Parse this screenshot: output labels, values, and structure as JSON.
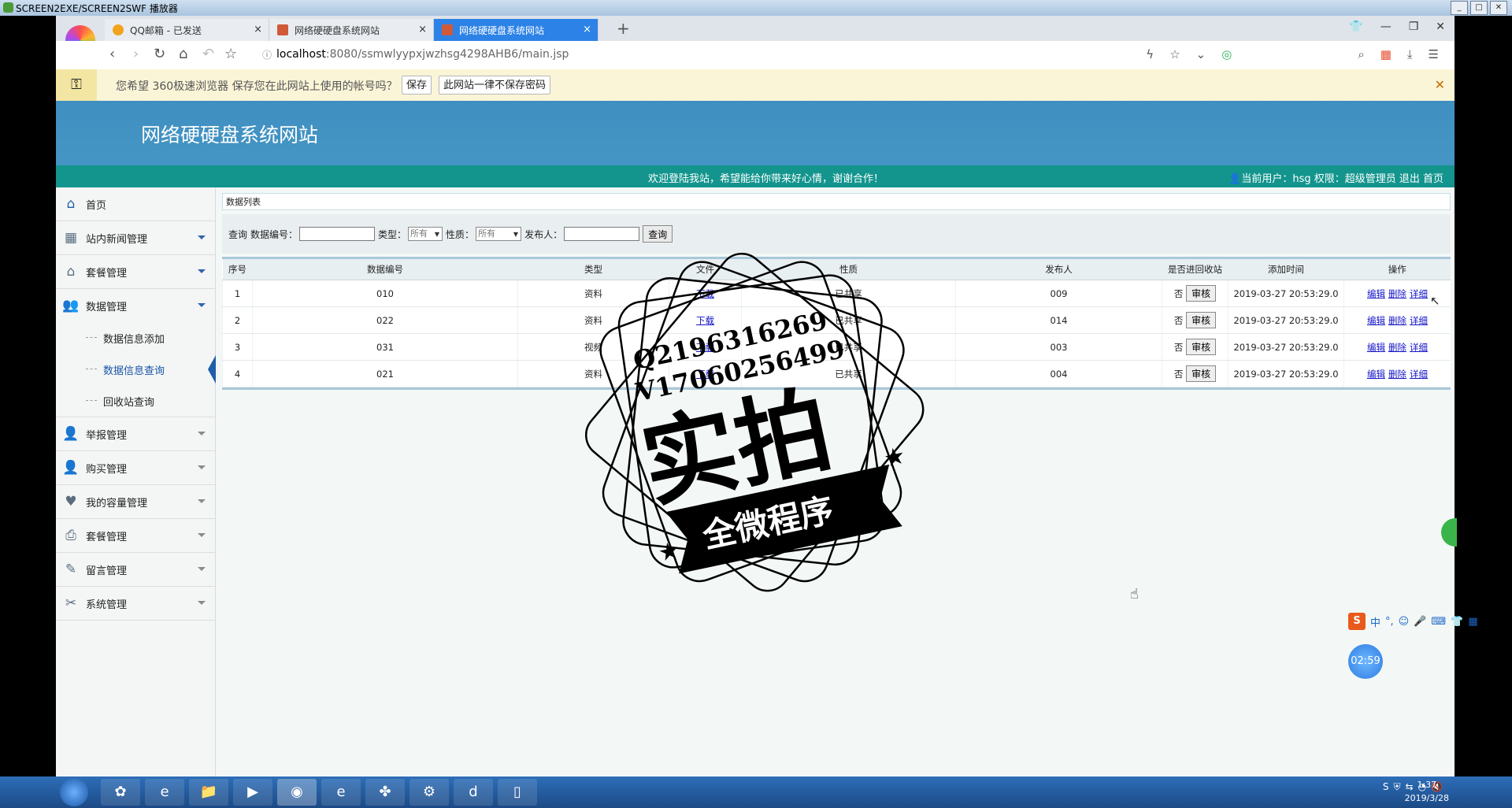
{
  "player": {
    "title": "SCREEN2EXE/SCREEN2SWF 播放器"
  },
  "browser": {
    "tabs": [
      {
        "title": "QQ邮箱 - 已发送",
        "active": false
      },
      {
        "title": "网络硬硬盘系统网站",
        "active": false
      },
      {
        "title": "网络硬硬盘系统网站",
        "active": true
      }
    ],
    "url": {
      "host": "localhost",
      "path": ":8080/ssmwlyypxjwzhsg4298AHB6/main.jsp"
    },
    "password_bar": {
      "message": "您希望 360极速浏览器 保存您在此网站上使用的帐号吗？",
      "save_label": "保存",
      "never_label": "此网站一律不保存密码"
    }
  },
  "site": {
    "title": "网络硬硬盘系统网站",
    "welcome": "欢迎登陆我站，希望能给你带来好心情，谢谢合作！",
    "user_info": "当前用户：hsg  权限：超级管理员  退出  首页"
  },
  "sidebar": {
    "home": "首页",
    "menus": [
      {
        "label": "站内新闻管理",
        "icon": "grid-icon"
      },
      {
        "label": "套餐管理",
        "icon": "house-icon"
      },
      {
        "label": "数据管理",
        "icon": "users-icon"
      },
      {
        "label": "举报管理",
        "icon": "person-icon"
      },
      {
        "label": "购买管理",
        "icon": "person-icon"
      },
      {
        "label": "我的容量管理",
        "icon": "heart-icon"
      },
      {
        "label": "套餐管理",
        "icon": "printer-icon"
      },
      {
        "label": "留言管理",
        "icon": "note-icon"
      },
      {
        "label": "系统管理",
        "icon": "tools-icon"
      }
    ],
    "sub_items": [
      "数据信息添加",
      "数据信息查询",
      "回收站查询"
    ]
  },
  "panel": {
    "title": "数据列表",
    "search": {
      "query_label": "查询",
      "number_label": "数据编号：",
      "type_label": "类型：",
      "type_value": "所有",
      "nature_label": "性质：",
      "nature_value": "所有",
      "publisher_label": "发布人：",
      "button": "查询"
    },
    "columns": [
      "序号",
      "数据编号",
      "类型",
      "文件",
      "性质",
      "发布人",
      "是否进回收站",
      "添加时间",
      "操作"
    ],
    "rows": [
      {
        "idx": "1",
        "number": "010",
        "type": "资料",
        "file": "下载",
        "nature": "已共享",
        "publisher": "009",
        "recycle": "否",
        "audit": "审核",
        "time": "2019-03-27 20:53:29.0"
      },
      {
        "idx": "2",
        "number": "022",
        "type": "资料",
        "file": "下载",
        "nature": "已共享",
        "publisher": "014",
        "recycle": "否",
        "audit": "审核",
        "time": "2019-03-27 20:53:29.0"
      },
      {
        "idx": "3",
        "number": "031",
        "type": "视频",
        "file": "下载",
        "nature": "已共享",
        "publisher": "003",
        "recycle": "否",
        "audit": "审核",
        "time": "2019-03-27 20:53:29.0"
      },
      {
        "idx": "4",
        "number": "021",
        "type": "资料",
        "file": "下载",
        "nature": "已共享",
        "publisher": "004",
        "recycle": "否",
        "audit": "审核",
        "time": "2019-03-27 20:53:29.0"
      }
    ],
    "actions": {
      "edit": "编辑",
      "delete": "删除",
      "detail": "详细"
    }
  },
  "watermark": {
    "line1": "Q2196316269",
    "line2": "V17060256499",
    "big": "实拍",
    "banner": "全微程序"
  },
  "overlay": {
    "timer": "02:59",
    "ime": "中"
  },
  "taskbar": {
    "time": "1:37",
    "date": "2019/3/28"
  }
}
